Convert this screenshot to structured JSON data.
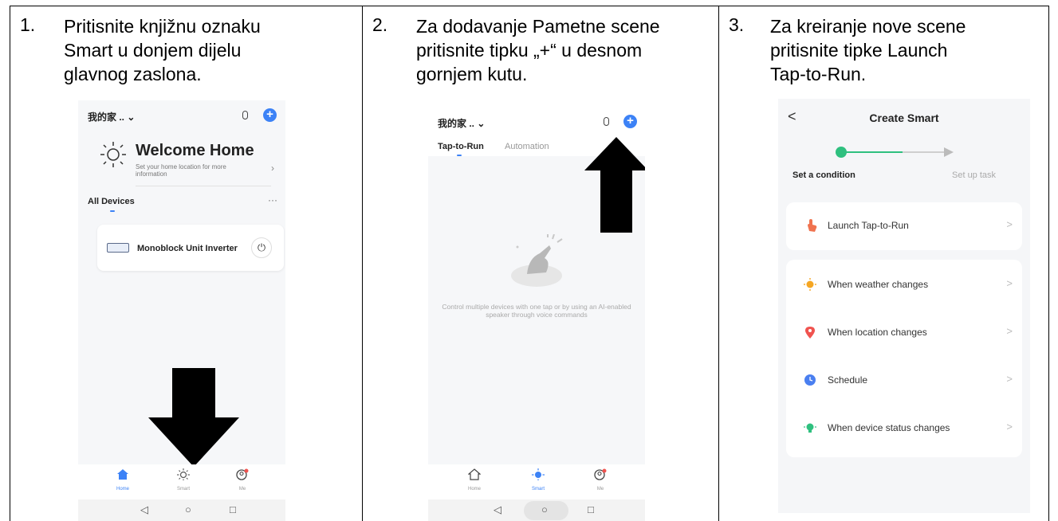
{
  "steps": [
    {
      "number": "1.",
      "lines": [
        "Pritisnite knjižnu oznaku",
        "Smart u donjem dijelu",
        "glavnog zaslona."
      ],
      "phone": {
        "home_title": "我的家 .. ⌄",
        "welcome_title": "Welcome Home",
        "welcome_sub": "Set your home location for more information",
        "section_title": "All Devices",
        "section_more": "···",
        "device_name": "Monoblock Unit Inverter",
        "tabs": [
          {
            "label": "Home",
            "icon": "home-icon",
            "color": "#3c82f6"
          },
          {
            "label": "Smart",
            "icon": "smart-sun-icon",
            "color": "#999999"
          },
          {
            "label": "Me",
            "icon": "me-icon",
            "color": "#999999"
          }
        ]
      }
    },
    {
      "number": "2.",
      "lines": [
        "Za dodavanje Pametne scene",
        "pritisnite tipku „+“ u desnom",
        "gornjem kutu."
      ],
      "phone": {
        "home_title": "我的家 .. ⌄",
        "tab_active": "Tap-to-Run",
        "tab_inactive": "Automation",
        "empty_text": "Control multiple devices with one tap or by using an AI-enabled speaker through voice commands",
        "tabs": [
          {
            "label": "Home",
            "icon": "home-outline-icon",
            "color": "#999999"
          },
          {
            "label": "Smart",
            "icon": "smart-sun-icon",
            "color": "#3c82f6"
          },
          {
            "label": "Me",
            "icon": "me-icon",
            "color": "#999999"
          }
        ]
      }
    },
    {
      "number": "3.",
      "lines": [
        "Za kreiranje nove scene",
        "pritisnite tipke Launch",
        "Tap-to-Run."
      ],
      "phone": {
        "back": "<",
        "title": "Create Smart",
        "step_active": "Set a condition",
        "step_inactive": "Set up task",
        "launch": "Launch Tap-to-Run",
        "conditions": [
          {
            "label": "When weather changes",
            "icon": "sun-icon",
            "color": "#f5a623"
          },
          {
            "label": "When location changes",
            "icon": "location-pin-icon",
            "color": "#f0534f"
          },
          {
            "label": "Schedule",
            "icon": "clock-icon",
            "color": "#4a7ff0"
          },
          {
            "label": "When device status changes",
            "icon": "device-status-icon",
            "color": "#2fc07f"
          }
        ],
        "chevron": ">"
      }
    }
  ],
  "nav": {
    "back": "◁",
    "home": "○",
    "recent": "□"
  },
  "accent": "#3c82f6"
}
